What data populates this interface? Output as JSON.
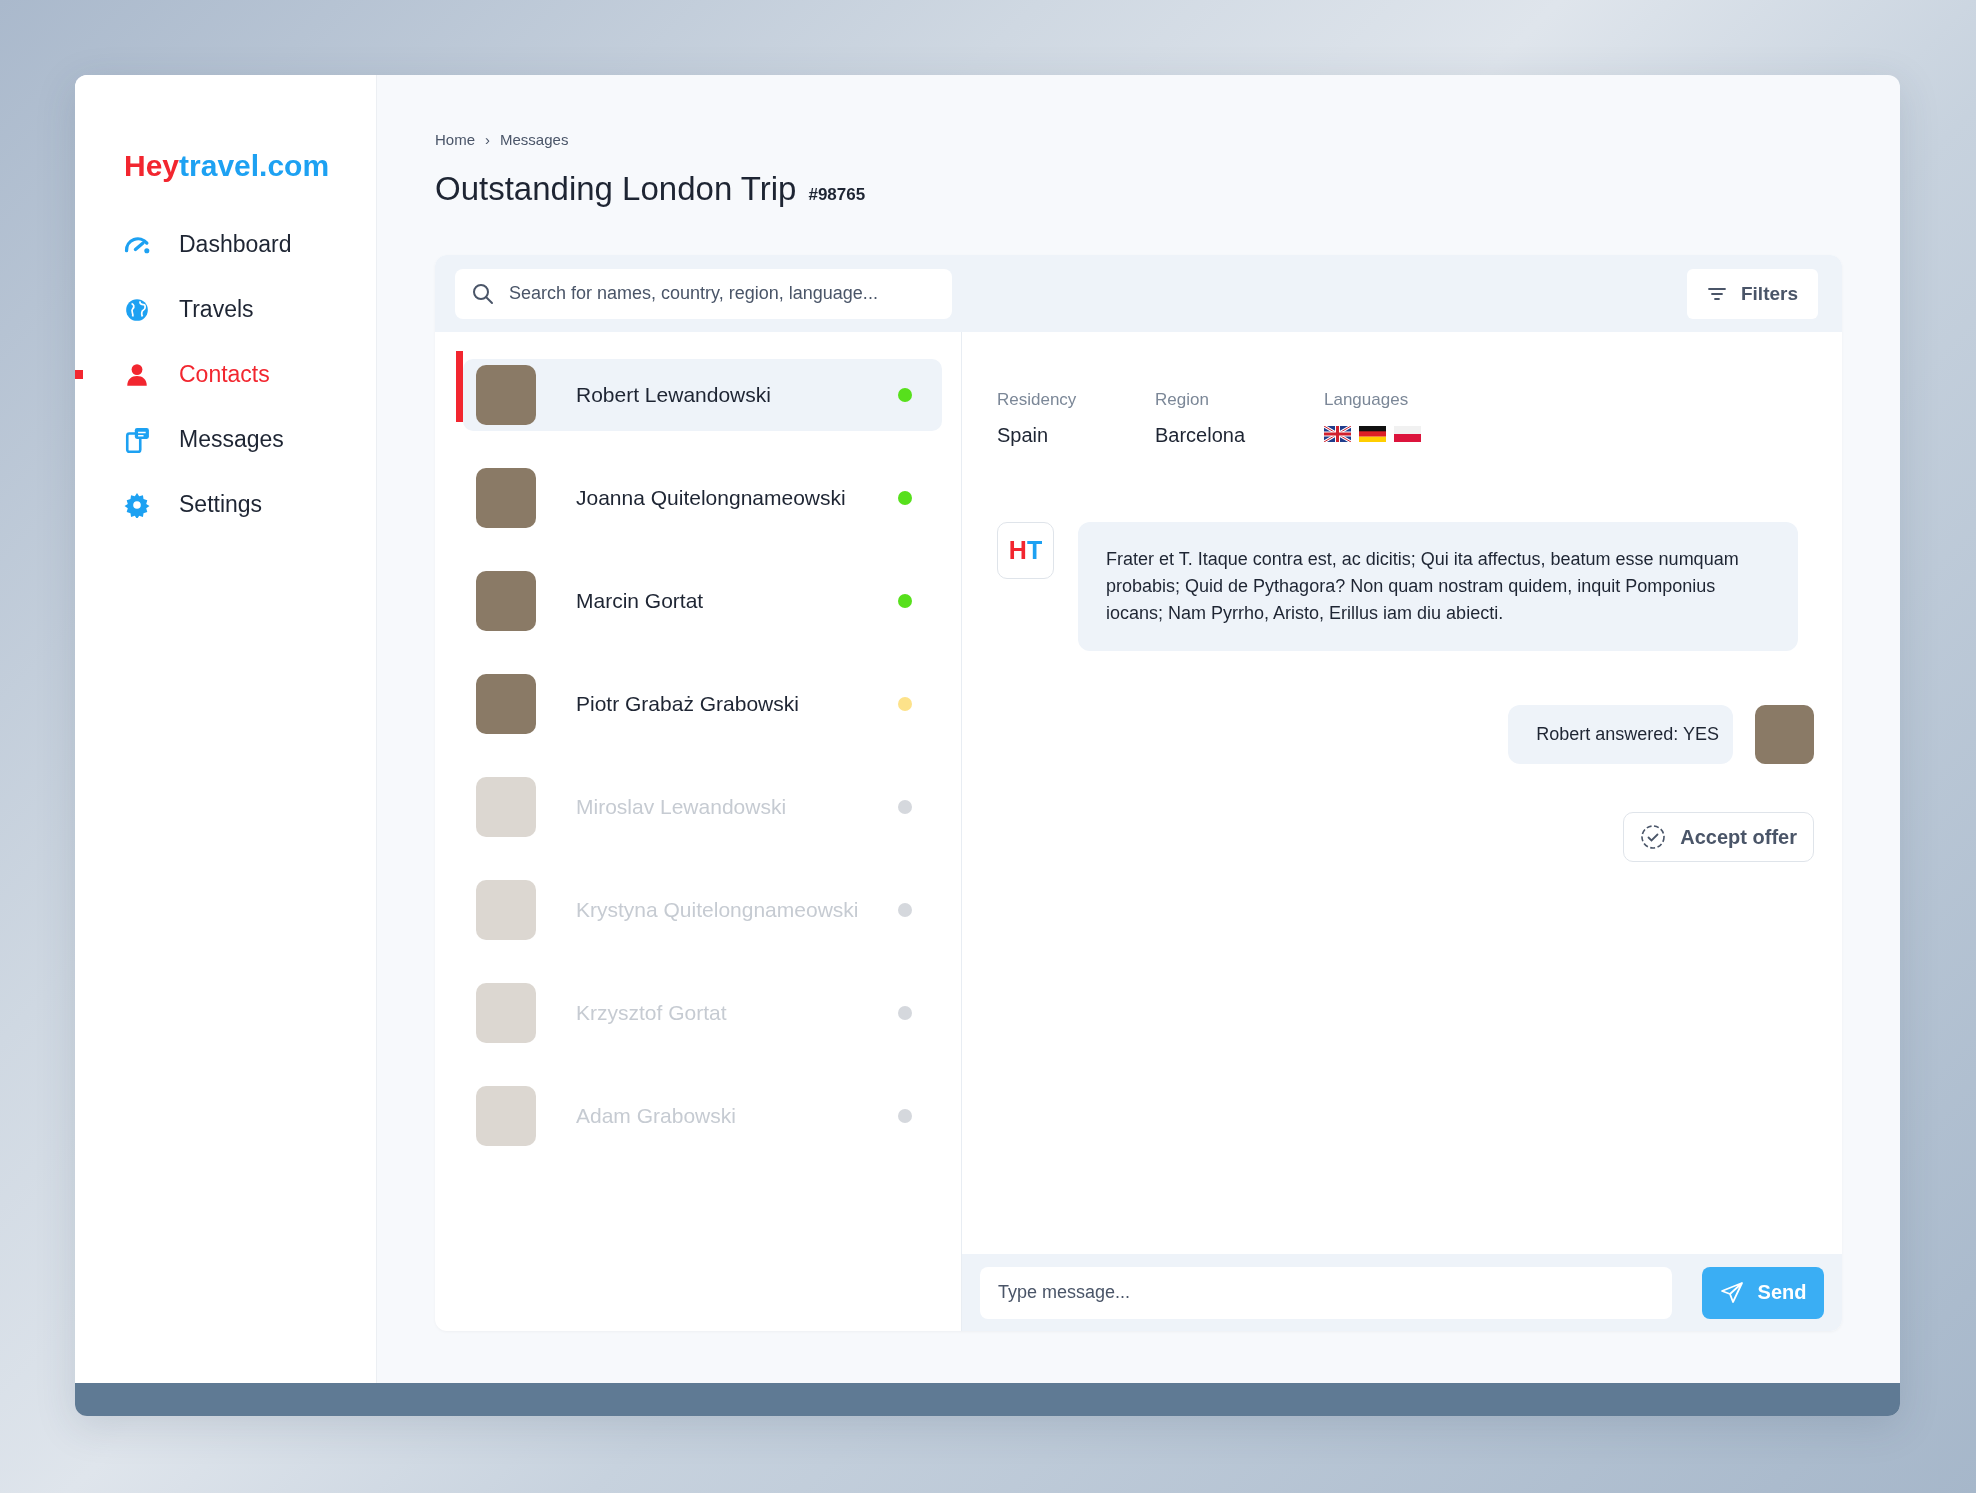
{
  "logo": {
    "first": "Hey",
    "second": "travel.com"
  },
  "nav": {
    "items": [
      {
        "label": "Dashboard",
        "selected": false
      },
      {
        "label": "Travels",
        "selected": false
      },
      {
        "label": "Contacts",
        "selected": true
      },
      {
        "label": "Messages",
        "selected": false
      },
      {
        "label": "Settings",
        "selected": false
      }
    ]
  },
  "breadcrumb": [
    "Home",
    "Messages"
  ],
  "breadcrumb_separator": "›",
  "title": "Outstanding London Trip",
  "trip_number": "#98765",
  "search": {
    "placeholder": "Search for names, country, region, language..."
  },
  "filters_button": "Filters",
  "contacts": [
    {
      "name": "Robert Lewandowski",
      "selected": true,
      "disabled": false,
      "color": "#57e01c"
    },
    {
      "name": "Joanna Quitelongnameowski",
      "selected": false,
      "disabled": false,
      "color": "#57e01c"
    },
    {
      "name": "Marcin Gortat",
      "selected": false,
      "disabled": false,
      "color": "#57e01c"
    },
    {
      "name": "Piotr Grabaż Grabowski",
      "selected": false,
      "disabled": false,
      "color": "#fde28a"
    },
    {
      "name": "Miroslav Lewandowski",
      "selected": false,
      "disabled": true,
      "color": "#d5d8dd"
    },
    {
      "name": "Krystyna Quitelongnameowski",
      "selected": false,
      "disabled": true,
      "color": "#d5d8dd"
    },
    {
      "name": "Krzysztof Gortat",
      "selected": false,
      "disabled": true,
      "color": "#d5d8dd"
    },
    {
      "name": "Adam Grabowski",
      "selected": false,
      "disabled": true,
      "color": "#d5d8dd"
    }
  ],
  "details": [
    {
      "label": "Residency",
      "value": "Spain"
    },
    {
      "label": "Region",
      "value": "Barcelona"
    }
  ],
  "languages_label": "Languages",
  "sender_badge": {
    "first": "H",
    "second": "T"
  },
  "messages": [
    {
      "kind": "incoming",
      "text": "Frater et T. Itaque contra est, ac dicitis; Qui ita affectus, beatum esse numquam probabis; Quid de Pythagora? Non quam nostram quidem, inquit Pomponius iocans; Nam Pyrrho, Aristo, Erillus iam diu abiecti."
    },
    {
      "kind": "outgoing",
      "text": "Robert answered: YES"
    }
  ],
  "accept_button": "Accept offer",
  "composer": {
    "placeholder": "Type message..."
  },
  "send_button": "Send"
}
